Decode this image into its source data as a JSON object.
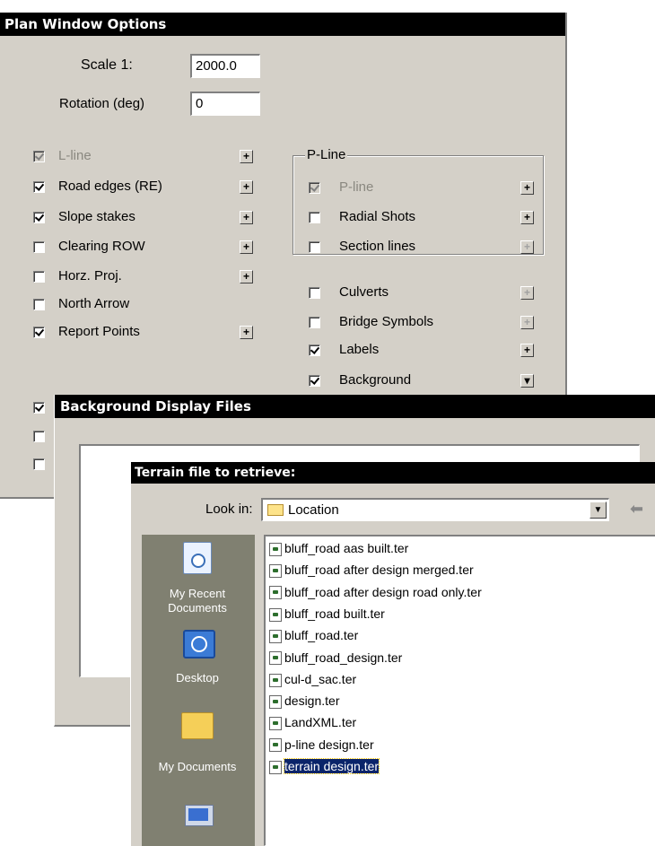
{
  "plan_window": {
    "title": "Plan Window Options",
    "scale_label": "Scale  1:",
    "scale_value": "2000.0",
    "rotation_label": "Rotation (deg)",
    "rotation_value": "0",
    "left_options": [
      {
        "label": "L-line",
        "checked": true,
        "enabled": false
      },
      {
        "label": "Road edges (RE)",
        "checked": true,
        "enabled": true
      },
      {
        "label": "Slope stakes",
        "checked": true,
        "enabled": true
      },
      {
        "label": "Clearing ROW",
        "checked": false,
        "enabled": true
      },
      {
        "label": "Horz. Proj.",
        "checked": false,
        "enabled": true
      },
      {
        "label": "North Arrow",
        "checked": false,
        "enabled": true
      },
      {
        "label": "Report Points",
        "checked": true,
        "enabled": true
      }
    ],
    "pline_group_title": "P-Line",
    "pline_options": [
      {
        "label": "P-line",
        "checked": true,
        "enabled": false
      },
      {
        "label": "Radial Shots",
        "checked": false,
        "enabled": true
      },
      {
        "label": "Section lines",
        "checked": false,
        "enabled": true
      }
    ],
    "right_options": [
      {
        "label": "Culverts",
        "checked": false
      },
      {
        "label": "Bridge Symbols",
        "checked": false
      },
      {
        "label": "Labels",
        "checked": true
      },
      {
        "label": "Background",
        "checked": true
      }
    ],
    "plus_glyph": "+",
    "background_btn_glyph": "▾"
  },
  "background_dialog": {
    "title": "Background Display Files"
  },
  "terrain_dialog": {
    "title": "Terrain file to retrieve:",
    "look_in_label": "Look in:",
    "look_in_value": "Location",
    "places": [
      "My Recent Documents",
      "Desktop",
      "My Documents"
    ],
    "files": [
      "bluff_road aas built.ter",
      "bluff_road after design merged.ter",
      "bluff_road after design road only.ter",
      "bluff_road built.ter",
      "bluff_road.ter",
      "bluff_road_design.ter",
      "cul-d_sac.ter",
      "design.ter",
      "LandXML.ter",
      "p-line design.ter",
      "terrain design.ter"
    ],
    "selected_file": "terrain design.ter",
    "back_arrow": "⬅"
  }
}
